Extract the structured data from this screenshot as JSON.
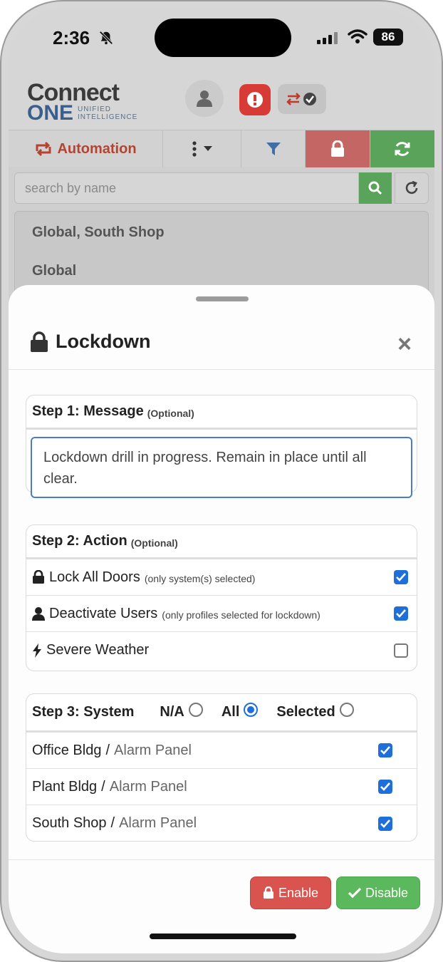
{
  "status_bar": {
    "time": "2:36",
    "battery": "86",
    "icons": [
      "bell-slash-icon",
      "signal-icon",
      "wifi-icon",
      "battery-icon"
    ]
  },
  "app_header": {
    "logo_connect": "Connect",
    "logo_one": "ONE",
    "logo_sub_line1": "UNIFIED",
    "logo_sub_line2": "INTELLIGENCE",
    "icons": [
      "user-icon",
      "alert-icon",
      "transfer-icon"
    ]
  },
  "toolbar": {
    "automation_label": "Automation",
    "colors": {
      "lock": "#c46664",
      "refresh": "#5aa35a",
      "automation": "#b6432f"
    }
  },
  "search": {
    "placeholder": "search by name"
  },
  "background_list": {
    "items": [
      "Global, South Shop",
      "Global"
    ]
  },
  "sheet": {
    "title": "Lockdown",
    "close": "×",
    "step1": {
      "title": "Step 1: Message",
      "optional": "(Optional)",
      "message": "Lockdown drill in progress. Remain in place until all clear."
    },
    "step2": {
      "title": "Step 2: Action",
      "optional": "(Optional)",
      "actions": [
        {
          "label": "Lock All Doors",
          "note": "(only system(s) selected)",
          "checked": true,
          "icon": "lock-icon"
        },
        {
          "label": "Deactivate Users",
          "note": "(only profiles selected for lockdown)",
          "checked": true,
          "icon": "user-icon"
        },
        {
          "label": "Severe Weather",
          "note": "",
          "checked": false,
          "icon": "bolt-icon"
        }
      ]
    },
    "step3": {
      "title": "Step 3: System",
      "options": [
        "N/A",
        "All",
        "Selected"
      ],
      "selected_option": "All",
      "systems": [
        {
          "building": "Office Bldg",
          "sep": "/",
          "panel": "Alarm Panel",
          "checked": true
        },
        {
          "building": "Plant Bldg",
          "sep": "/",
          "panel": "Alarm Panel",
          "checked": true
        },
        {
          "building": "South Shop",
          "sep": "/",
          "panel": "Alarm Panel",
          "checked": true
        }
      ]
    },
    "buttons": {
      "enable": "Enable",
      "disable": "Disable",
      "colors": {
        "enable": "#d9534f",
        "disable": "#5cb85c"
      }
    }
  }
}
